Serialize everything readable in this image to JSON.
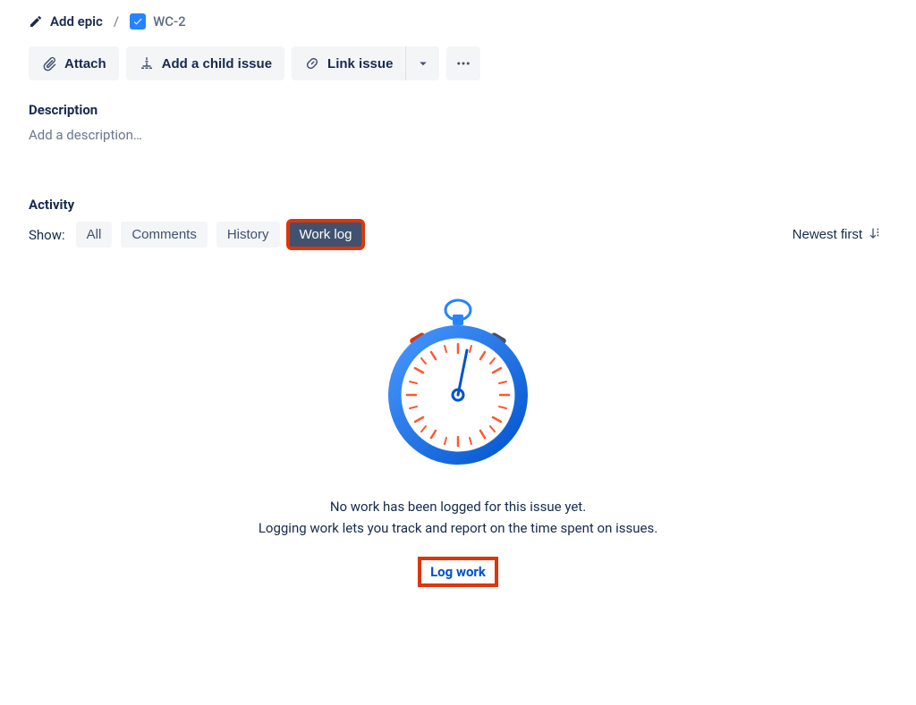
{
  "breadcrumb": {
    "epic_label": "Add epic",
    "issue_key": "WC-2"
  },
  "toolbar": {
    "attach_label": "Attach",
    "child_label": "Add a child issue",
    "link_label": "Link issue"
  },
  "description": {
    "title": "Description",
    "placeholder": "Add a description…"
  },
  "activity": {
    "title": "Activity",
    "show_label": "Show:",
    "tabs": {
      "all": "All",
      "comments": "Comments",
      "history": "History",
      "worklog": "Work log"
    },
    "sort_label": "Newest first"
  },
  "empty": {
    "line1": "No work has been logged for this issue yet.",
    "line2": "Logging work lets you track and report on the time spent on issues.",
    "button": "Log work"
  },
  "highlight_color": "#DE350B"
}
